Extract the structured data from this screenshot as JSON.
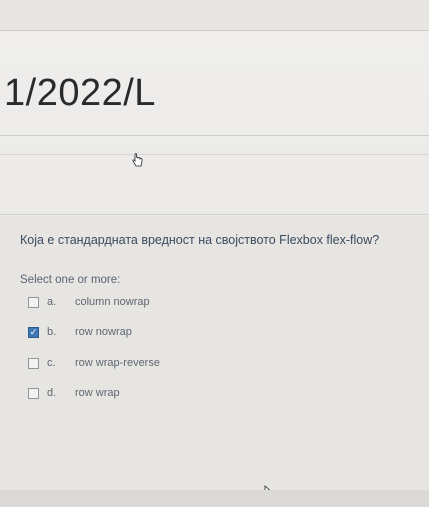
{
  "page_code": "1/2022/L",
  "question": {
    "text": "Која е стандардната вредност на својството Flexbox flex-flow?",
    "prompt": "Select one or more:",
    "options": [
      {
        "letter": "a.",
        "label": "column nowrap",
        "checked": false
      },
      {
        "letter": "b.",
        "label": "row nowrap",
        "checked": true
      },
      {
        "letter": "c.",
        "label": "row wrap-reverse",
        "checked": false
      },
      {
        "letter": "d.",
        "label": "row wrap",
        "checked": false
      }
    ]
  },
  "colors": {
    "checked_fill": "#3f79b5",
    "question_text": "#3b4a5e"
  },
  "icons": {
    "hand_cursor": "hand-cursor-icon",
    "arrow_pointer": "arrow-pointer-icon",
    "checkmark": "checkmark-icon"
  }
}
